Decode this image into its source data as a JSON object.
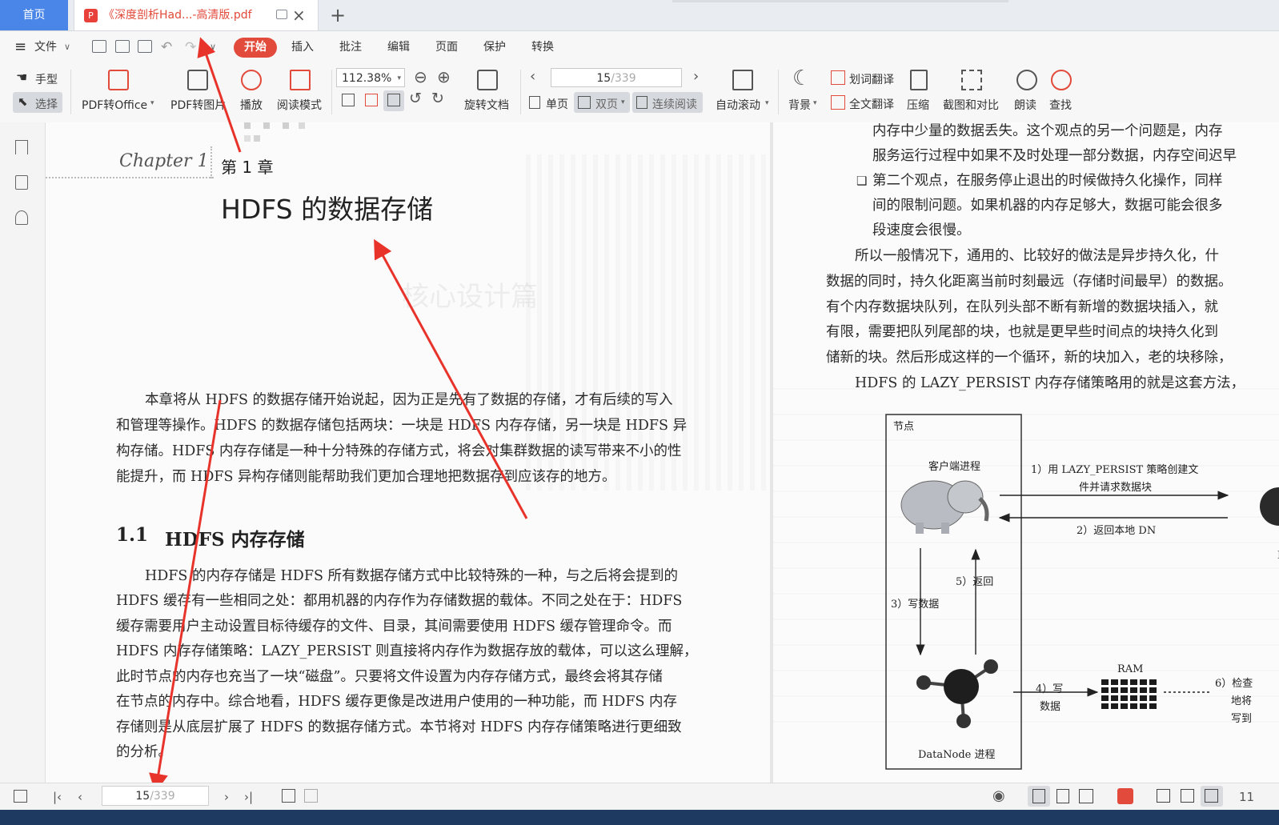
{
  "tabs": {
    "home": "首页",
    "document": "《深度剖析Had...-高清版.pdf",
    "new_tab": "+",
    "close": "×"
  },
  "menu": {
    "file": "文件",
    "items": [
      "开始",
      "插入",
      "批注",
      "编辑",
      "页面",
      "保护",
      "转换"
    ]
  },
  "ribbon": {
    "hand": "手型",
    "select": "选择",
    "pdf_to_office": "PDF转Office",
    "pdf_to_image": "PDF转图片",
    "play": "播放",
    "read_mode": "阅读模式",
    "zoom": "112.38%",
    "rotate": "旋转文档",
    "page_current": "15",
    "page_total": "/339",
    "single": "单页",
    "double": "双页",
    "continuous": "连续阅读",
    "auto_scroll": "自动滚动",
    "background": "背景",
    "word_translate": "划词翻译",
    "full_translate": "全文翻译",
    "compress": "压缩",
    "screenshot_compare": "截图和对比",
    "read_aloud": "朗读",
    "find": "查找"
  },
  "left_page": {
    "chapter_script": "Chapter 1",
    "chapter_no": "第 1 章",
    "chapter_title": "HDFS 的数据存储",
    "ghost_title": "核心设计篇",
    "intro": [
      "本章将从 HDFS 的数据存储开始说起，因为正是先有了数据的存储，才有后续的写入",
      "和管理等操作。HDFS 的数据存储包括两块：一块是 HDFS 内存存储，另一块是 HDFS 异",
      "构存储。HDFS 内存存储是一种十分特殊的存储方式，将会对集群数据的读写带来不小的性",
      "能提升，而 HDFS 异构存储则能帮助我们更加合理地把数据存到应该存的地方。"
    ],
    "section_no": "1.1",
    "section_title": "HDFS 内存存储",
    "section_body": [
      "HDFS 的内存存储是 HDFS 所有数据存储方式中比较特殊的一种，与之后将会提到的",
      "HDFS 缓存有一些相同之处：都用机器的内存作为存储数据的载体。不同之处在于：HDFS",
      "缓存需要用户主动设置目标待缓存的文件、目录，其间需要使用 HDFS 缓存管理命令。而",
      "HDFS 内存存储策略：LAZY_PERSIST 则直接将内存作为数据存放的载体，可以这么理解，",
      "此时节点的内存也充当了一块“磁盘”。只要将文件设置为内存存储方式，最终会将其存储",
      "在节点的内存中。综合地看，HDFS 缓存更像是改进用户使用的一种功能，而 HDFS 内存",
      "存储则是从底层扩展了 HDFS 的数据存储方式。本节将对 HDFS 内存存储策略进行更细致",
      "的分析。"
    ]
  },
  "right_page": {
    "lines": [
      "内存中少量的数据丢失。这个观点的另一个问题是，内存",
      "服务运行过程中如果不及时处理一部分数据，内存空间迟早",
      "第二个观点，在服务停止退出的时候做持久化操作，同样",
      "间的限制问题。如果机器的内存足够大，数据可能会很多",
      "段速度会很慢。",
      "所以一般情况下，通用的、比较好的做法是异步持久化，什",
      "数据的同时，持久化距离当前时刻最远（存储时间最早）的数据。",
      "有个内存数据块队列，在队列头部不断有新增的数据块插入，就",
      "有限，需要把队列尾部的块，也就是更早些时间点的块持久化到",
      "储新的块。然后形成这样的一个循环，新的块加入，老的块移除，",
      "HDFS 的 LAZY_PERSIST 内存存储策略用的就是这套方法，"
    ],
    "bullet": "❑",
    "diagram": {
      "node": "节点",
      "client": "客户端进程",
      "step1_a": "1）用 LAZY_PERSIST 策略创建文",
      "step1_b": "件并请求数据块",
      "step2": "2）返回本地 DN",
      "step3": "3）写数据",
      "step5": "5）返回",
      "step4_a": "4）写",
      "step4_b": "数据",
      "ram": "RAM",
      "step6_a": "6）检查",
      "step6_b": "地将",
      "step6_c": "写到",
      "datanode": "DataNode 进程",
      "edge_n": "N"
    }
  },
  "statusbar": {
    "page_current": "15",
    "page_total": "/339",
    "zoom_partial": "11"
  },
  "colors": {
    "accent": "#e24a3b",
    "home_tab": "#4a86e8",
    "arrow": "#e8332b"
  }
}
